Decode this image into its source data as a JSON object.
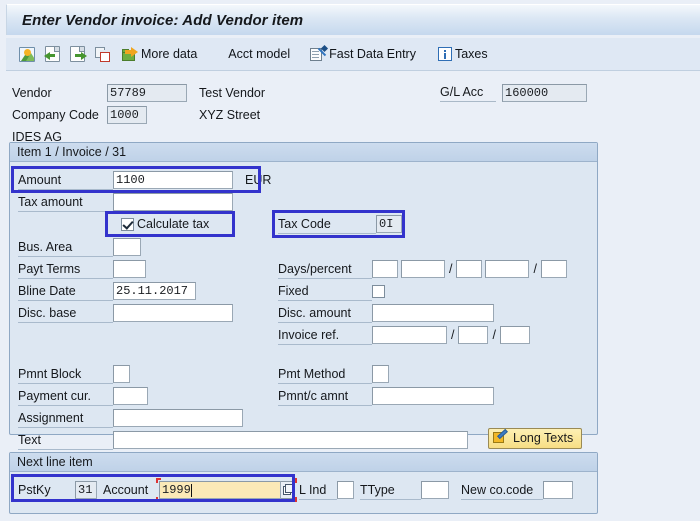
{
  "window": {
    "title": "Enter Vendor invoice: Add Vendor item"
  },
  "toolbar": {
    "items": [
      {
        "name": "picture-icon",
        "icon": "picture-icon",
        "label": ""
      },
      {
        "name": "document-back-icon",
        "icon": "document-back-icon",
        "label": ""
      },
      {
        "name": "document-forward-icon",
        "icon": "document-forward-icon",
        "label": ""
      },
      {
        "name": "window-copy-icon",
        "icon": "window-copy-icon",
        "label": ""
      },
      {
        "name": "more-data-button",
        "icon": "folder-arrow-icon",
        "label": "More data"
      },
      {
        "name": "acct-model-button",
        "icon": "",
        "label": "Acct model"
      },
      {
        "name": "fast-data-entry-button",
        "icon": "form-pen-icon",
        "label": "Fast Data Entry"
      },
      {
        "name": "taxes-button",
        "icon": "info-icon",
        "label": "Taxes"
      }
    ],
    "more_data_label": "More data",
    "acct_model_label": "Acct model",
    "fast_data_entry_label": "Fast Data Entry",
    "taxes_label": "Taxes"
  },
  "header": {
    "vendor_label": "Vendor",
    "vendor_value": "57789",
    "vendor_name": "Test Vendor",
    "company_code_label": "Company Code",
    "company_code_value": "1000",
    "company_street": "XYZ Street",
    "company_name": "IDES AG",
    "gl_acc_label": "G/L Acc",
    "gl_acc_value": "160000"
  },
  "item_panel": {
    "title": "Item 1 / Invoice / 31",
    "amount_label": "Amount",
    "amount_value": "1100",
    "currency": "EUR",
    "tax_amount_label": "Tax amount",
    "tax_amount_value": "",
    "calculate_tax_label": "Calculate tax",
    "calculate_tax_checked": true,
    "tax_code_label": "Tax Code",
    "tax_code_value": "0I",
    "bus_area_label": "Bus. Area",
    "bus_area_value": "",
    "payt_terms_label": "Payt Terms",
    "payt_terms_value": "",
    "bline_date_label": "Bline Date",
    "bline_date_value": "25.11.2017",
    "disc_base_label": "Disc. base",
    "disc_base_value": "",
    "days_percent_label": "Days/percent",
    "days_percent_values": [
      "",
      "",
      "",
      "",
      ""
    ],
    "fixed_label": "Fixed",
    "fixed_checked": false,
    "disc_amount_label": "Disc. amount",
    "disc_amount_value": "",
    "invoice_ref_label": "Invoice ref.",
    "invoice_ref_values": [
      "",
      "",
      ""
    ],
    "pmnt_block_label": "Pmnt Block",
    "pmnt_block_value": "",
    "pmt_method_label": "Pmt Method",
    "pmt_method_value": "",
    "payment_cur_label": "Payment cur.",
    "payment_cur_value": "",
    "pmnt_c_amnt_label": "Pmnt/c amnt",
    "pmnt_c_amnt_value": "",
    "assignment_label": "Assignment",
    "assignment_value": "",
    "text_label": "Text",
    "text_value": "",
    "long_texts_label": "Long Texts",
    "separator_slash": "/"
  },
  "next_line_item": {
    "title": "Next line item",
    "pstky_label": "PstKy",
    "pstky_value": "31",
    "account_label": "Account",
    "account_value": "1999",
    "account_focused": true,
    "l_ind_label": "L Ind",
    "l_ind_value": "",
    "ttype_label": "TType",
    "ttype_value": "",
    "new_cocode_label": "New co.code",
    "new_cocode_value": ""
  },
  "colors": {
    "highlight_box": "#3333CC",
    "focus_field_bg": "#FBE9B7",
    "focus_marker": "#DD3333",
    "panel_bg": "#DDE7F2",
    "page_bg": "#EAEFF7",
    "long_texts_btn": "#F7DE84"
  }
}
